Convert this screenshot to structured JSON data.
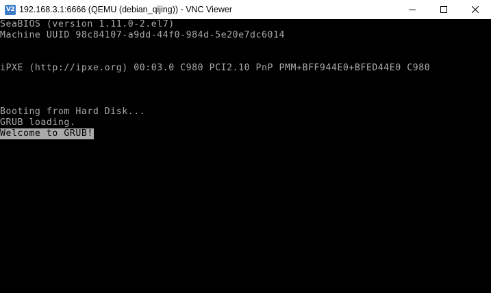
{
  "window": {
    "app_icon_label": "V2",
    "title": "192.168.3.1:6666 (QEMU (debian_qijing)) - VNC Viewer"
  },
  "controls": {
    "minimize": "minimize-icon",
    "maximize": "maximize-icon",
    "close": "close-icon"
  },
  "console": {
    "lines": [
      "SeaBIOS (version 1.11.0-2.el7)",
      "Machine UUID 98c84107-a9dd-44f0-984d-5e20e7dc6014",
      "iPXE (http://ipxe.org) 00:03.0 C980 PCI2.10 PnP PMM+BFF944E0+BFED44E0 C980",
      "Booting from Hard Disk...",
      "GRUB loading.",
      "Welcome to GRUB!"
    ],
    "text_color": "#aaaaaa",
    "background_color": "#000000",
    "highlight_background": "#aaaaaa",
    "highlight_text_color": "#000000"
  }
}
